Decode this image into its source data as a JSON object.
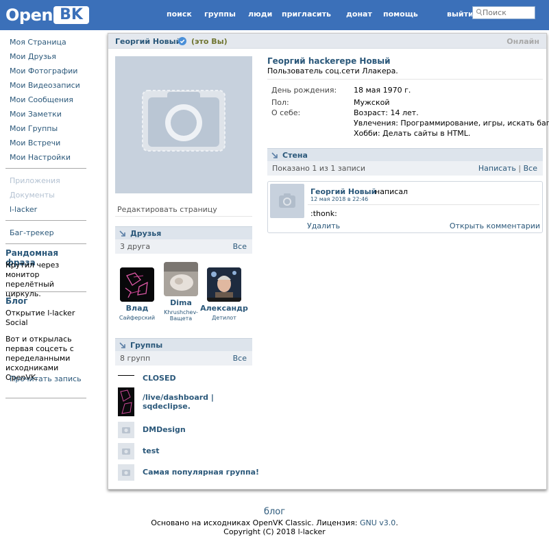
{
  "header": {
    "logo_open": "Open",
    "logo_bk": "BK",
    "nav": [
      "поиск",
      "группы",
      "люди",
      "пригласить",
      "донат",
      "помощь",
      "выйти"
    ],
    "search_placeholder": "Поиск"
  },
  "sidebar": {
    "links": [
      "Моя Страница",
      "Мои Друзья",
      "Мои Фотографии",
      "Мои Видеозаписи",
      "Мои Сообщения",
      "Мои Заметки",
      "Мои Группы",
      "Мои Встречи",
      "Мои Настройки"
    ],
    "disabled_links": [
      "Приложения",
      "Документы"
    ],
    "extra_link": "l-lacker",
    "bugtracker": "Баг-трекер",
    "random_heading": "Рандомная фраза",
    "random_text": "Крутил через монитор перелётный циркуль.",
    "blog_heading": "Блог",
    "blog_title": "Открытие l-lacker Social",
    "blog_text": "Вот и открылась первая соцсеть с переделанными исходниками OpenVK.",
    "blog_read": "Прочитать запись"
  },
  "profile": {
    "head_name": "Георгий Новый",
    "its_you": "(это Вы)",
    "online": "Онлайн",
    "edit_page": "Редактировать страницу",
    "full_name": "Георгий hackerepe Новый",
    "status": "Пользователь соц.сети Ллакера.",
    "info": [
      {
        "label": "День рождения:",
        "value": "18 мая 1970 г."
      },
      {
        "label": "Пол:",
        "value": "Мужской"
      },
      {
        "label": "О себе:",
        "value": "Возраст: 14 лет."
      },
      {
        "label": "",
        "value": "Увлечения: Программирование, игры, искать баги."
      },
      {
        "label": "",
        "value": "Хобби: Делать сайты в HTML."
      }
    ]
  },
  "friends": {
    "title": "Друзья",
    "count": "3 друга",
    "all": "Все",
    "items": [
      {
        "first": "Влад",
        "last": "Сайферский"
      },
      {
        "first": "Dima",
        "last": "Khrushchev-Ващета"
      },
      {
        "first": "Александр",
        "last": "Детилот"
      }
    ]
  },
  "groups": {
    "title": "Группы",
    "count": "8 групп",
    "all": "Все",
    "items": [
      "CLOSED",
      "/live/dashboard | sqdeclipse.",
      "DMDesign",
      "test",
      "Самая популярная группа!"
    ]
  },
  "wall": {
    "title": "Стена",
    "shown": "Показано 1 из 1 записи",
    "write": "Написать",
    "sep": "|",
    "all": "Все",
    "post": {
      "author": "Георгий Новый",
      "wrote": "написал",
      "date": "12 мая 2018 в 22:46",
      "text": ":thonk:",
      "delete": "Удалить",
      "open_comments": "Открыть комментарии"
    }
  },
  "footer": {
    "blog": "блог",
    "line1_prefix": "Основано на исходниках OpenVK Classic. Лицензия: ",
    "license": "GNU v3.0",
    "line1_suffix": ".",
    "line2": "Copyright (C) 2018 l-lacker"
  },
  "colors": {
    "header_bg": "#3b70b9",
    "link": "#2b587a",
    "section_bar": "#dde4ec",
    "placeholder_bg": "#c7d1dd"
  }
}
